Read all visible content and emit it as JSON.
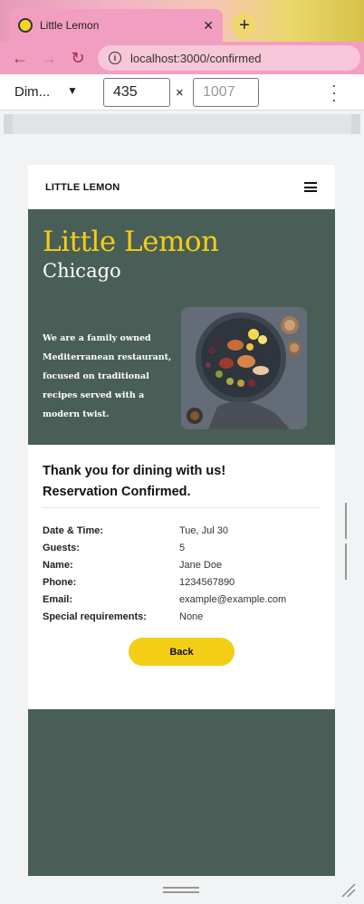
{
  "browser": {
    "tab_title": "Little Lemon",
    "tab_close": "✕",
    "new_tab": "+",
    "url": "localhost:3000/confirmed",
    "back_glyph": "←",
    "forward_glyph": "→",
    "reload_glyph": "↻"
  },
  "devtools": {
    "device_label": "Dim...",
    "width": "435",
    "height": "1007",
    "times": "×"
  },
  "page": {
    "brand": "LITTLE LEMON",
    "hero": {
      "title": "Little Lemon",
      "subtitle": "Chicago",
      "description": "We are a family owned Mediterranean restaurant, focused on traditional recipes served with a modern twist."
    },
    "confirmation": {
      "thanks": "Thank you for dining with us!",
      "status": "Reservation Confirmed.",
      "details": [
        {
          "label": "Date & Time:",
          "value": "Tue, Jul 30"
        },
        {
          "label": "Guests:",
          "value": "5"
        },
        {
          "label": "Name:",
          "value": "Jane Doe"
        },
        {
          "label": "Phone:",
          "value": "1234567890"
        },
        {
          "label": "Email:",
          "value": "example@example.com"
        },
        {
          "label": "Special requirements:",
          "value": "None"
        }
      ],
      "back_label": "Back"
    }
  },
  "colors": {
    "primary_green": "#495e57",
    "primary_yellow": "#f4ce14"
  }
}
